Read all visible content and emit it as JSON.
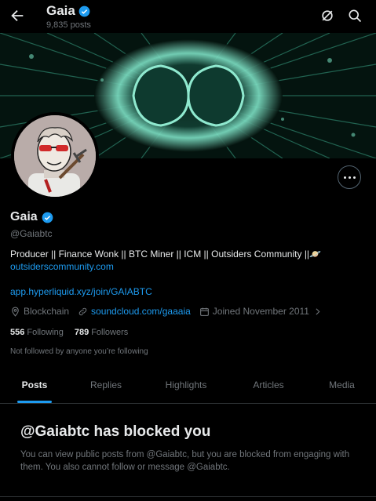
{
  "header": {
    "title": "Gaia",
    "posts_count": "9,835 posts",
    "icons": [
      "back-arrow-icon",
      "verified-badge-icon",
      "grok-icon",
      "search-icon"
    ]
  },
  "profile": {
    "name": "Gaia",
    "handle": "@Gaiabtc",
    "bio": "Producer || Finance Wonk || BTC Miner || ICM || Outsiders Community ||🪐",
    "link1": "outsiderscommunity.com",
    "link2": "app.hyperliquid.xyz/join/GAIABTC",
    "location": "Blockchain",
    "website": "soundcloud.com/gaaaia",
    "joined": "Joined November 2011",
    "following_count": "556",
    "following_label": "Following",
    "followers_count": "789",
    "followers_label": "Followers",
    "not_followed": "Not followed by anyone you’re following"
  },
  "tabs": [
    {
      "label": "Posts",
      "active": true
    },
    {
      "label": "Replies",
      "active": false
    },
    {
      "label": "Highlights",
      "active": false
    },
    {
      "label": "Articles",
      "active": false
    },
    {
      "label": "Media",
      "active": false
    }
  ],
  "blocked": {
    "title": "@Gaiabtc has blocked you",
    "text": "You can view public posts from @Gaiabtc, but you are blocked from engaging with them. You also cannot follow or message @Gaiabtc."
  },
  "colors": {
    "accent": "#1d9bf0",
    "background": "#000000",
    "muted": "#71767b",
    "text": "#e7e9ea"
  }
}
